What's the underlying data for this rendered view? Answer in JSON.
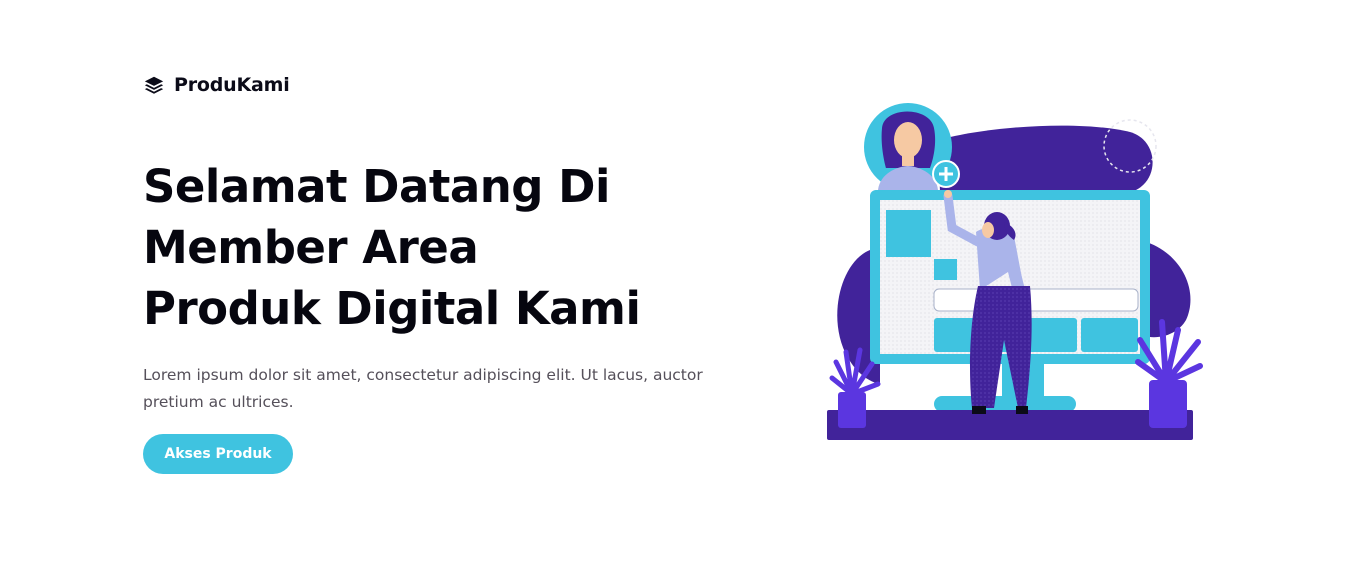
{
  "brand": {
    "icon": "layers-icon",
    "name": "ProduKami"
  },
  "hero": {
    "title_lines": [
      "Selamat Datang Di",
      "Member Area",
      "Produk Digital Kami"
    ],
    "description": "Lorem ipsum dolor sit amet, consectetur adipiscing elit. Ut lacus, auctor pretium ac ultrices.",
    "cta_label": "Akses Produk"
  },
  "illustration": {
    "icon": "member-area-illustration"
  },
  "colors": {
    "accent": "#3fc3e0",
    "purple_dark": "#41239a",
    "purple_light": "#aab4ea",
    "plant_purple": "#5b36e0",
    "text_dark": "#06060f",
    "text_muted": "#55505a"
  }
}
